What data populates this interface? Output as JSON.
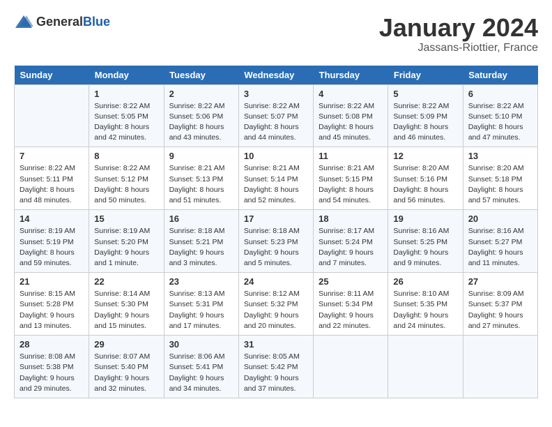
{
  "header": {
    "logo_general": "General",
    "logo_blue": "Blue",
    "title": "January 2024",
    "subtitle": "Jassans-Riottier, France"
  },
  "weekdays": [
    "Sunday",
    "Monday",
    "Tuesday",
    "Wednesday",
    "Thursday",
    "Friday",
    "Saturday"
  ],
  "weeks": [
    [
      {
        "day": "",
        "sunrise": "",
        "sunset": "",
        "daylight": ""
      },
      {
        "day": "1",
        "sunrise": "Sunrise: 8:22 AM",
        "sunset": "Sunset: 5:05 PM",
        "daylight": "Daylight: 8 hours and 42 minutes."
      },
      {
        "day": "2",
        "sunrise": "Sunrise: 8:22 AM",
        "sunset": "Sunset: 5:06 PM",
        "daylight": "Daylight: 8 hours and 43 minutes."
      },
      {
        "day": "3",
        "sunrise": "Sunrise: 8:22 AM",
        "sunset": "Sunset: 5:07 PM",
        "daylight": "Daylight: 8 hours and 44 minutes."
      },
      {
        "day": "4",
        "sunrise": "Sunrise: 8:22 AM",
        "sunset": "Sunset: 5:08 PM",
        "daylight": "Daylight: 8 hours and 45 minutes."
      },
      {
        "day": "5",
        "sunrise": "Sunrise: 8:22 AM",
        "sunset": "Sunset: 5:09 PM",
        "daylight": "Daylight: 8 hours and 46 minutes."
      },
      {
        "day": "6",
        "sunrise": "Sunrise: 8:22 AM",
        "sunset": "Sunset: 5:10 PM",
        "daylight": "Daylight: 8 hours and 47 minutes."
      }
    ],
    [
      {
        "day": "7",
        "sunrise": "Sunrise: 8:22 AM",
        "sunset": "Sunset: 5:11 PM",
        "daylight": "Daylight: 8 hours and 48 minutes."
      },
      {
        "day": "8",
        "sunrise": "Sunrise: 8:22 AM",
        "sunset": "Sunset: 5:12 PM",
        "daylight": "Daylight: 8 hours and 50 minutes."
      },
      {
        "day": "9",
        "sunrise": "Sunrise: 8:21 AM",
        "sunset": "Sunset: 5:13 PM",
        "daylight": "Daylight: 8 hours and 51 minutes."
      },
      {
        "day": "10",
        "sunrise": "Sunrise: 8:21 AM",
        "sunset": "Sunset: 5:14 PM",
        "daylight": "Daylight: 8 hours and 52 minutes."
      },
      {
        "day": "11",
        "sunrise": "Sunrise: 8:21 AM",
        "sunset": "Sunset: 5:15 PM",
        "daylight": "Daylight: 8 hours and 54 minutes."
      },
      {
        "day": "12",
        "sunrise": "Sunrise: 8:20 AM",
        "sunset": "Sunset: 5:16 PM",
        "daylight": "Daylight: 8 hours and 56 minutes."
      },
      {
        "day": "13",
        "sunrise": "Sunrise: 8:20 AM",
        "sunset": "Sunset: 5:18 PM",
        "daylight": "Daylight: 8 hours and 57 minutes."
      }
    ],
    [
      {
        "day": "14",
        "sunrise": "Sunrise: 8:19 AM",
        "sunset": "Sunset: 5:19 PM",
        "daylight": "Daylight: 8 hours and 59 minutes."
      },
      {
        "day": "15",
        "sunrise": "Sunrise: 8:19 AM",
        "sunset": "Sunset: 5:20 PM",
        "daylight": "Daylight: 9 hours and 1 minute."
      },
      {
        "day": "16",
        "sunrise": "Sunrise: 8:18 AM",
        "sunset": "Sunset: 5:21 PM",
        "daylight": "Daylight: 9 hours and 3 minutes."
      },
      {
        "day": "17",
        "sunrise": "Sunrise: 8:18 AM",
        "sunset": "Sunset: 5:23 PM",
        "daylight": "Daylight: 9 hours and 5 minutes."
      },
      {
        "day": "18",
        "sunrise": "Sunrise: 8:17 AM",
        "sunset": "Sunset: 5:24 PM",
        "daylight": "Daylight: 9 hours and 7 minutes."
      },
      {
        "day": "19",
        "sunrise": "Sunrise: 8:16 AM",
        "sunset": "Sunset: 5:25 PM",
        "daylight": "Daylight: 9 hours and 9 minutes."
      },
      {
        "day": "20",
        "sunrise": "Sunrise: 8:16 AM",
        "sunset": "Sunset: 5:27 PM",
        "daylight": "Daylight: 9 hours and 11 minutes."
      }
    ],
    [
      {
        "day": "21",
        "sunrise": "Sunrise: 8:15 AM",
        "sunset": "Sunset: 5:28 PM",
        "daylight": "Daylight: 9 hours and 13 minutes."
      },
      {
        "day": "22",
        "sunrise": "Sunrise: 8:14 AM",
        "sunset": "Sunset: 5:30 PM",
        "daylight": "Daylight: 9 hours and 15 minutes."
      },
      {
        "day": "23",
        "sunrise": "Sunrise: 8:13 AM",
        "sunset": "Sunset: 5:31 PM",
        "daylight": "Daylight: 9 hours and 17 minutes."
      },
      {
        "day": "24",
        "sunrise": "Sunrise: 8:12 AM",
        "sunset": "Sunset: 5:32 PM",
        "daylight": "Daylight: 9 hours and 20 minutes."
      },
      {
        "day": "25",
        "sunrise": "Sunrise: 8:11 AM",
        "sunset": "Sunset: 5:34 PM",
        "daylight": "Daylight: 9 hours and 22 minutes."
      },
      {
        "day": "26",
        "sunrise": "Sunrise: 8:10 AM",
        "sunset": "Sunset: 5:35 PM",
        "daylight": "Daylight: 9 hours and 24 minutes."
      },
      {
        "day": "27",
        "sunrise": "Sunrise: 8:09 AM",
        "sunset": "Sunset: 5:37 PM",
        "daylight": "Daylight: 9 hours and 27 minutes."
      }
    ],
    [
      {
        "day": "28",
        "sunrise": "Sunrise: 8:08 AM",
        "sunset": "Sunset: 5:38 PM",
        "daylight": "Daylight: 9 hours and 29 minutes."
      },
      {
        "day": "29",
        "sunrise": "Sunrise: 8:07 AM",
        "sunset": "Sunset: 5:40 PM",
        "daylight": "Daylight: 9 hours and 32 minutes."
      },
      {
        "day": "30",
        "sunrise": "Sunrise: 8:06 AM",
        "sunset": "Sunset: 5:41 PM",
        "daylight": "Daylight: 9 hours and 34 minutes."
      },
      {
        "day": "31",
        "sunrise": "Sunrise: 8:05 AM",
        "sunset": "Sunset: 5:42 PM",
        "daylight": "Daylight: 9 hours and 37 minutes."
      },
      {
        "day": "",
        "sunrise": "",
        "sunset": "",
        "daylight": ""
      },
      {
        "day": "",
        "sunrise": "",
        "sunset": "",
        "daylight": ""
      },
      {
        "day": "",
        "sunrise": "",
        "sunset": "",
        "daylight": ""
      }
    ]
  ]
}
